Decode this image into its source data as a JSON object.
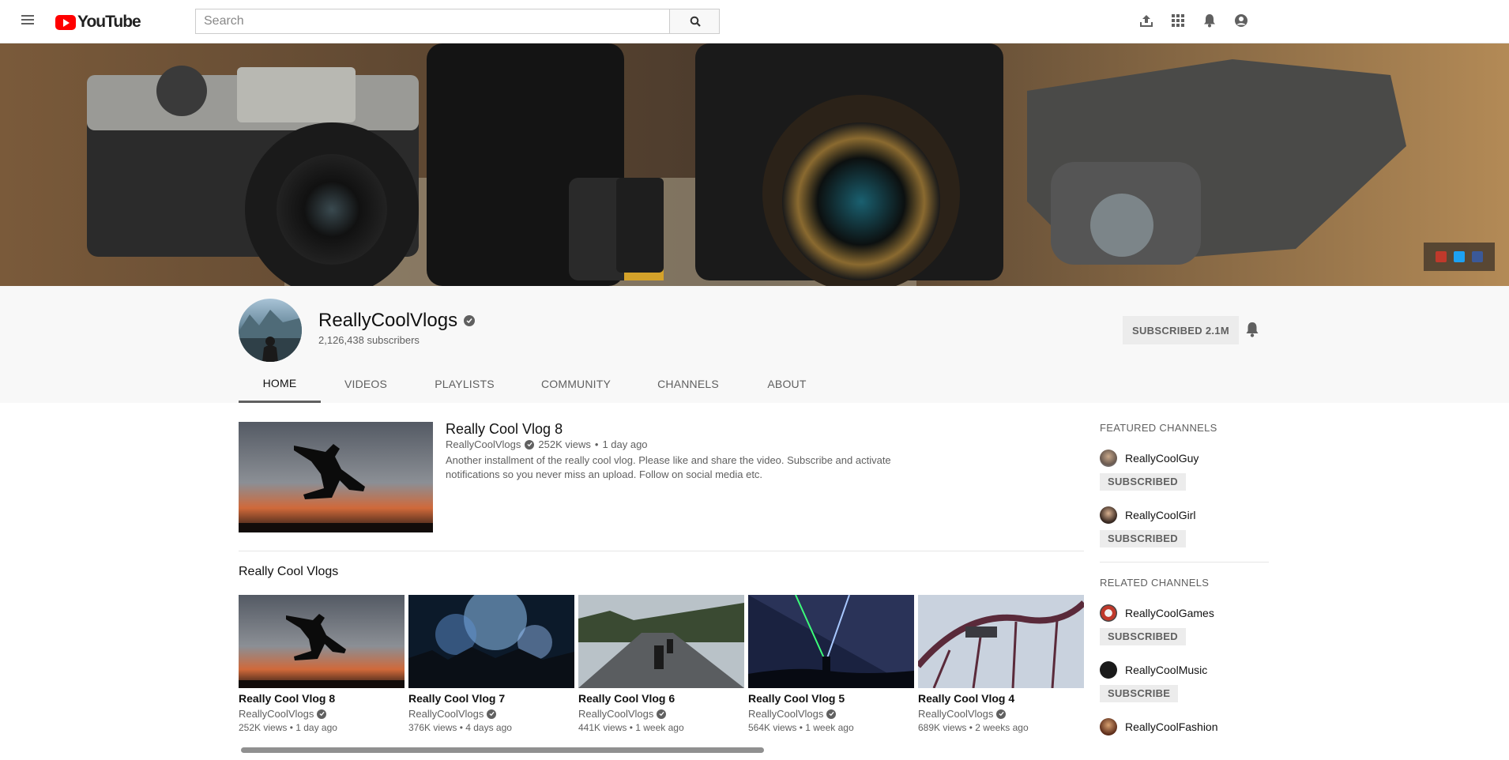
{
  "topbar": {
    "logo_text": "YouTube",
    "search_placeholder": "Search",
    "icons": [
      "upload-icon",
      "apps-icon",
      "notifications-icon",
      "account-icon"
    ]
  },
  "channel": {
    "name": "ReallyCoolVlogs",
    "subscribers": "2,126,438 subscribers",
    "subscribe_label": "SUBSCRIBED 2.1M",
    "tabs": [
      "HOME",
      "VIDEOS",
      "PLAYLISTS",
      "COMMUNITY",
      "CHANNELS",
      "ABOUT"
    ],
    "active_tab": "HOME"
  },
  "featured": {
    "title": "Really Cool Vlog 8",
    "channel": "ReallyCoolVlogs",
    "views": "252K views",
    "age": "1 day ago",
    "description": "Another installment of the really cool vlog. Please like and share the video. Subscribe and activate notifications so you never miss an upload. Follow on social media etc."
  },
  "shelf": {
    "title": "Really Cool Vlogs",
    "items": [
      {
        "title": "Really Cool Vlog 8",
        "channel": "ReallyCoolVlogs",
        "meta": "252K views • 1 day ago"
      },
      {
        "title": "Really Cool Vlog 7",
        "channel": "ReallyCoolVlogs",
        "meta": "376K views • 4 days ago"
      },
      {
        "title": "Really Cool Vlog 6",
        "channel": "ReallyCoolVlogs",
        "meta": "441K views • 1 week ago"
      },
      {
        "title": "Really Cool Vlog 5",
        "channel": "ReallyCoolVlogs",
        "meta": "564K views • 1 week ago"
      },
      {
        "title": "Really Cool Vlog 4",
        "channel": "ReallyCoolVlogs",
        "meta": "689K views • 2 weeks ago"
      }
    ]
  },
  "sidebar": {
    "featured_heading": "FEATURED CHANNELS",
    "featured": [
      {
        "name": "ReallyCoolGuy",
        "button": "SUBSCRIBED"
      },
      {
        "name": "ReallyCoolGirl",
        "button": "SUBSCRIBED"
      }
    ],
    "related_heading": "RELATED CHANNELS",
    "related": [
      {
        "name": "ReallyCoolGames",
        "button": "SUBSCRIBED"
      },
      {
        "name": "ReallyCoolMusic",
        "button": "SUBSCRIBE"
      },
      {
        "name": "ReallyCoolFashion",
        "button": ""
      }
    ]
  },
  "colors": {
    "brand_red": "#ff0000",
    "text_primary": "#111111",
    "text_secondary": "#606060",
    "button_gray": "#ececec",
    "header_bg": "#f8f8f8"
  }
}
